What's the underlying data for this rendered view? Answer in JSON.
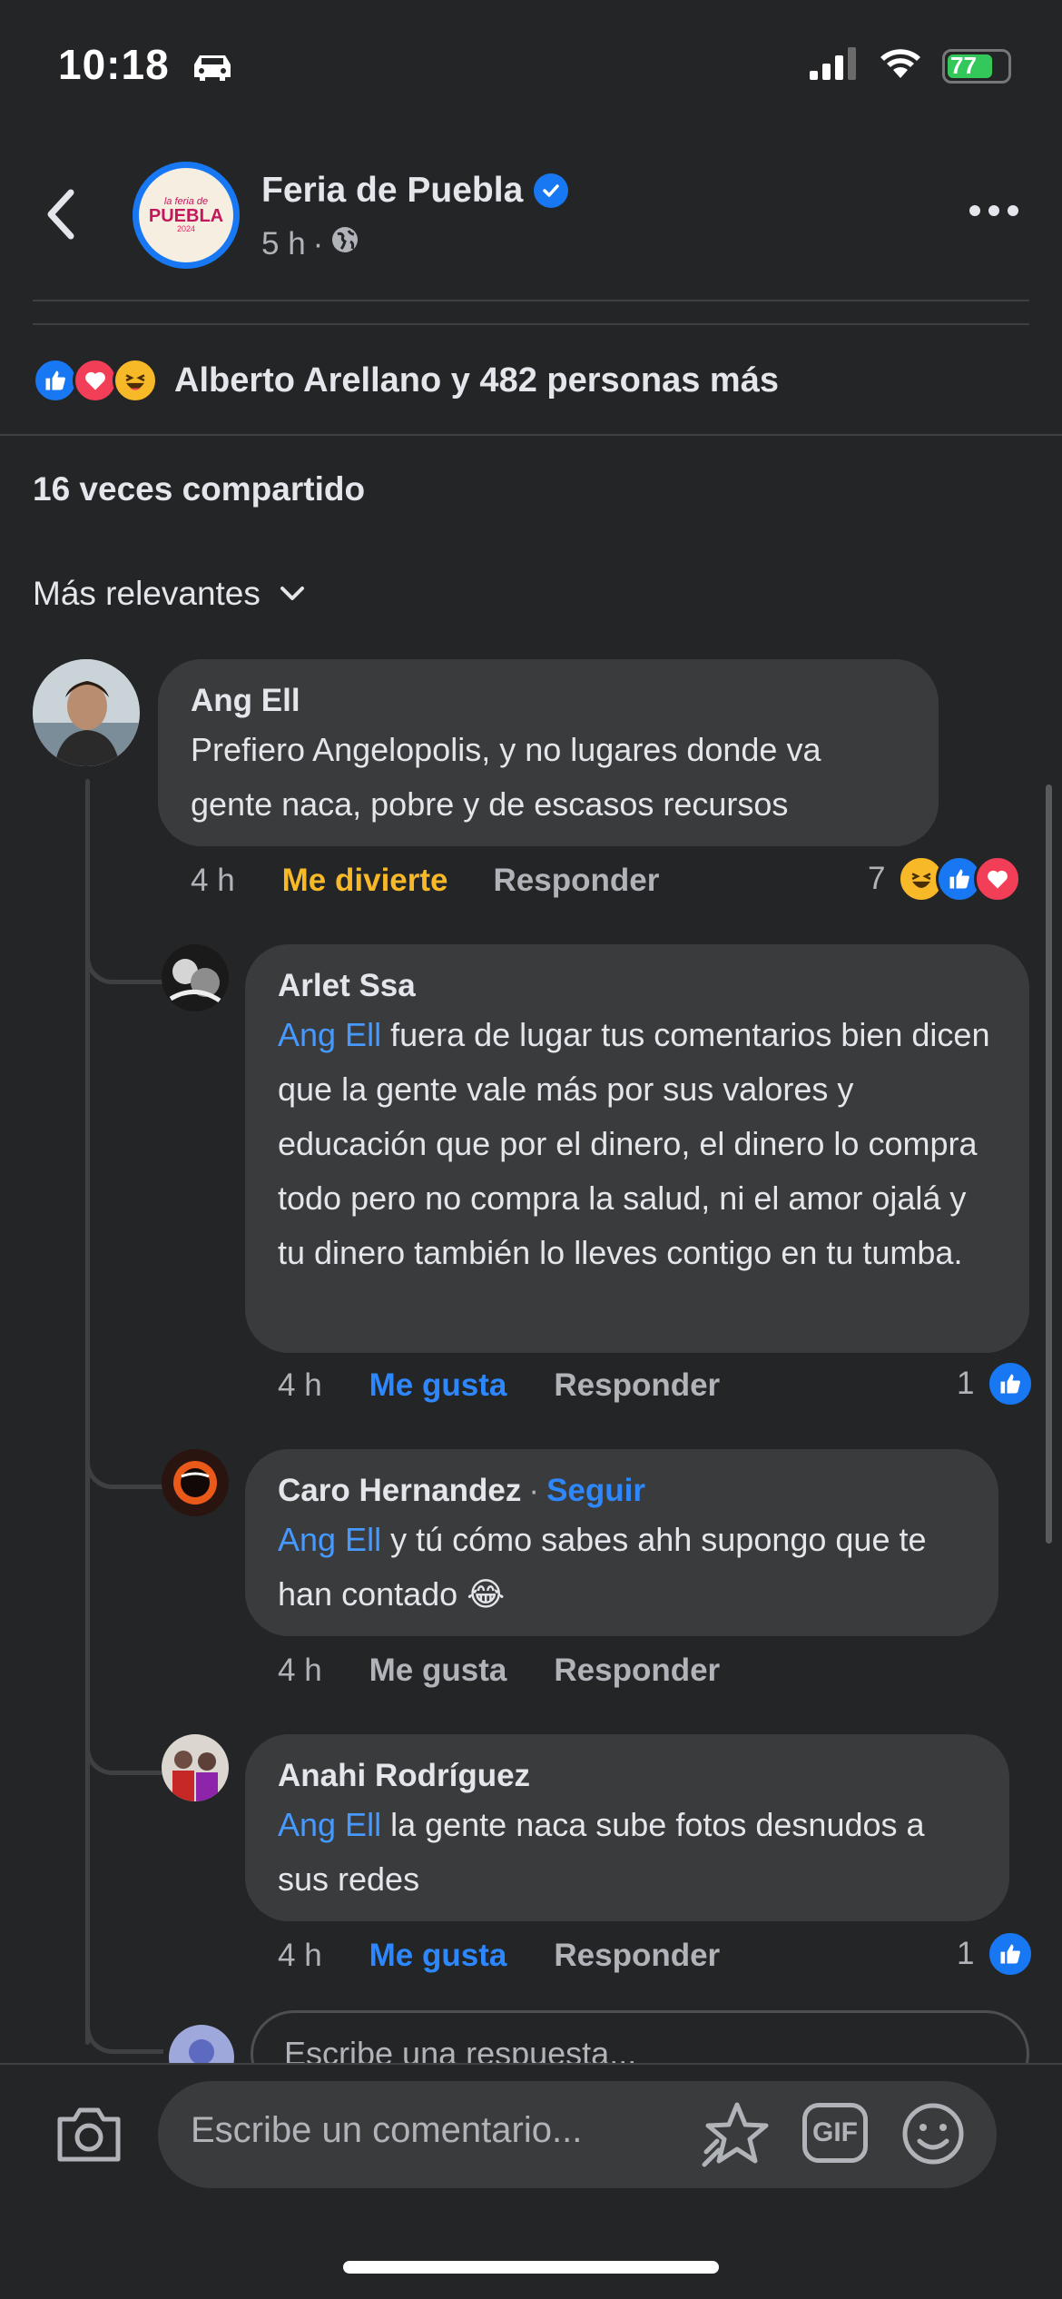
{
  "status_bar": {
    "time": "10:18",
    "battery": "77",
    "battery_level": 0.77,
    "icons": [
      "car-icon",
      "signal-icon",
      "wifi-icon",
      "battery-icon"
    ]
  },
  "header": {
    "page_name": "Feria de Puebla",
    "time_ago": "5 h",
    "separator": "·",
    "logo_text": {
      "line1": "la feria de",
      "line2": "PUEBLA",
      "line3": "2024"
    },
    "icons": [
      "back-arrow-icon",
      "verified-badge-icon",
      "globe-icon",
      "more-options-icon"
    ]
  },
  "reactions_summary": {
    "label": "Alberto Arellano y 482 personas más",
    "types": [
      "like",
      "love",
      "haha"
    ]
  },
  "shares": "16 veces compartido",
  "filter_label": "Más relevantes",
  "comments": [
    {
      "author": "Ang Ell",
      "text": "Prefiero Angelopolis, y no lugares donde va gente naca, pobre y de escasos recursos",
      "time": "4 h",
      "reaction_label": "Me divierte",
      "reply_label": "Responder",
      "reaction_count": "7",
      "reactions": [
        "haha",
        "like",
        "love"
      ]
    },
    {
      "author": "Arlet Ssa",
      "mention": "Ang Ell",
      "text": " fuera de lugar tus comentarios bien dicen que la gente vale más por sus valores y educación que por el dinero, el dinero lo compra todo pero no compra la salud, ni el amor ojalá y tu dinero también lo lleves contigo en tu tumba.",
      "time": "4 h",
      "reaction_label": "Me gusta",
      "reply_label": "Responder",
      "reaction_count": "1",
      "reactions": [
        "like"
      ]
    },
    {
      "author": "Caro Hernandez",
      "separator": "·",
      "follow_label": "Seguir",
      "mention": "Ang Ell",
      "text": " y tú cómo sabes ahh supongo que te han contado 😂",
      "time": "4 h",
      "reaction_label": "Me gusta",
      "reply_label": "Responder"
    },
    {
      "author": "Anahi Rodríguez",
      "mention": "Ang Ell",
      "text": " la gente naca sube fotos desnudos a sus redes",
      "time": "4 h",
      "reaction_label": "Me gusta",
      "reply_label": "Responder",
      "reaction_count": "1",
      "reactions": [
        "like"
      ]
    }
  ],
  "reply_input": {
    "placeholder": "Escribe una respuesta..."
  },
  "composer": {
    "placeholder": "Escribe un comentario...",
    "gif_label": "GIF",
    "icons": [
      "camera-icon",
      "sticker-icon",
      "gif-icon",
      "emoji-icon"
    ]
  },
  "colors": {
    "background": "#242526",
    "bubble": "#3a3b3c",
    "accent_blue": "#1877f2",
    "mention_blue": "#4599ff",
    "haha_yellow": "#f7b928",
    "love_red": "#f33e58"
  }
}
